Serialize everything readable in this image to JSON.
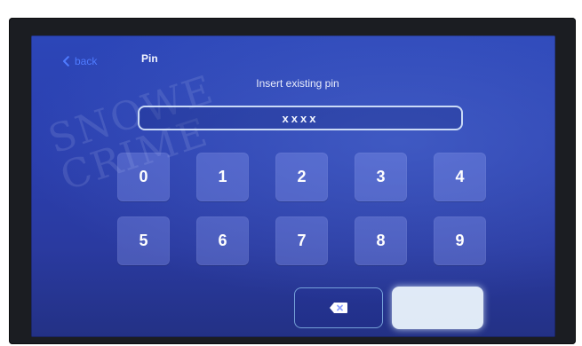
{
  "header": {
    "back_label": "back",
    "title": "Pin"
  },
  "pin": {
    "prompt": "Insert existing pin",
    "value": "xxxx"
  },
  "keypad": {
    "keys": [
      "0",
      "1",
      "2",
      "3",
      "4",
      "5",
      "6",
      "7",
      "8",
      "9"
    ]
  },
  "controls": {
    "backspace_icon": "backspace-icon",
    "confirm_label": ""
  },
  "watermark": {
    "line1": "SNOWE",
    "line2": "CRIME"
  },
  "colors": {
    "screen_bg": "#2c46b8",
    "back_link": "#4f7bff",
    "key_bg": "#7e8fe8",
    "field_border": "#dcebff",
    "confirm_bg": "#f0faff"
  }
}
